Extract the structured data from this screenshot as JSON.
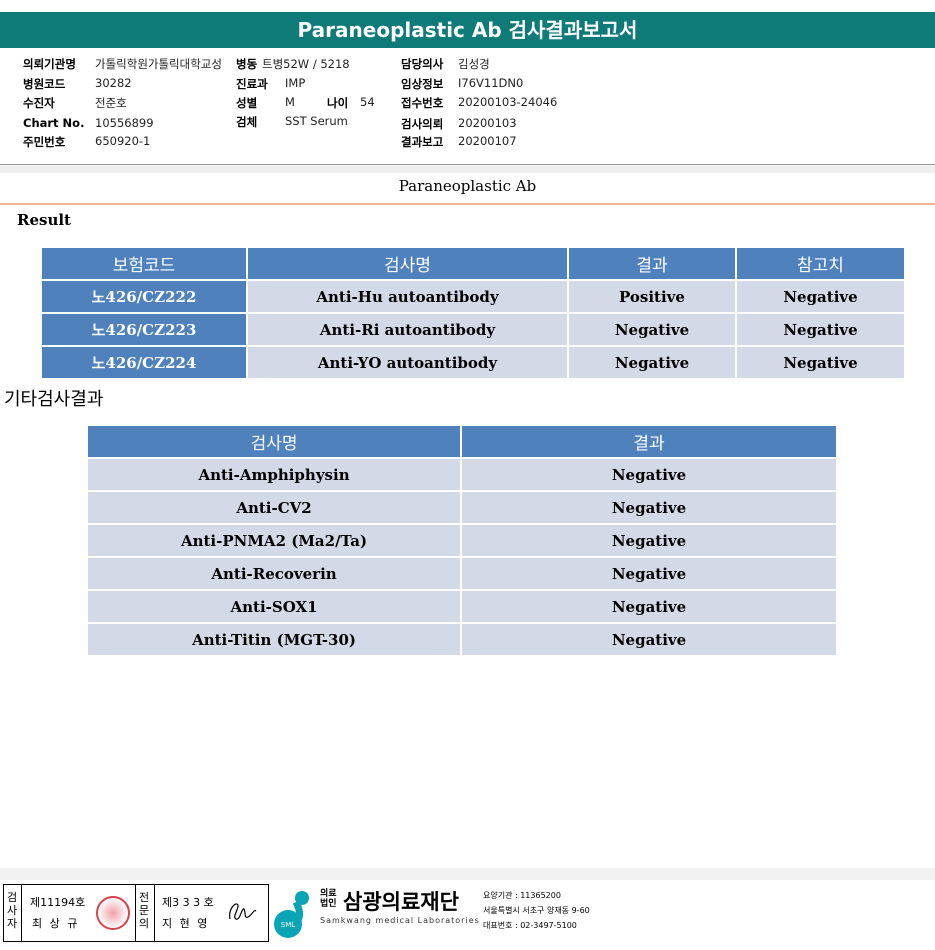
{
  "header": {
    "title": "Paraneoplastic Ab 검사결과보고서"
  },
  "info": {
    "institution_label": "의뢰기관명",
    "institution_value": "가톨릭학원가톨릭대학교성",
    "ward_label": "병동",
    "ward_value": "트병52W / 5218",
    "hospital_code_label": "병원코드",
    "hospital_code_value": "30282",
    "patient_label": "수진자",
    "patient_value": "전준호",
    "chart_label": "Chart No.",
    "chart_value": "10556899",
    "rrn_label": "주민번호",
    "rrn_value": "650920-1",
    "dept_label": "진료과",
    "dept_value": "IMP",
    "sex_label": "성별",
    "sex_value": "M",
    "age_label": "나이",
    "age_value": "54",
    "specimen_label": "검체",
    "specimen_value": "SST Serum",
    "doctor_label": "담당의사",
    "doctor_value": "김성경",
    "clinical_label": "임상정보",
    "clinical_value": "I76V11DN0",
    "receipt_label": "접수번호",
    "receipt_value": "20200103-24046",
    "request_label": "검사의뢰",
    "request_value": "20200103",
    "report_label": "결과보고",
    "report_value": "20200107"
  },
  "section": {
    "title": "Paraneoplastic Ab",
    "result_label": "Result",
    "other_label": "기타검사결과"
  },
  "results_table": {
    "headers": [
      "보험코드",
      "검사명",
      "결과",
      "참고치"
    ],
    "rows": [
      [
        "노426/CZ222",
        "Anti-Hu autoantibody",
        "Positive",
        "Negative"
      ],
      [
        "노426/CZ223",
        "Anti-Ri autoantibody",
        "Negative",
        "Negative"
      ],
      [
        "노426/CZ224",
        "Anti-YO autoantibody",
        "Negative",
        "Negative"
      ]
    ]
  },
  "other_table": {
    "headers": [
      "검사명",
      "결과"
    ],
    "rows": [
      [
        "Anti-Amphiphysin",
        "Negative"
      ],
      [
        "Anti-CV2",
        "Negative"
      ],
      [
        "Anti-PNMA2 (Ma2/Ta)",
        "Negative"
      ],
      [
        "Anti-Recoverin",
        "Negative"
      ],
      [
        "Anti-SOX1",
        "Negative"
      ],
      [
        "Anti-Titin (MGT-30)",
        "Negative"
      ]
    ]
  },
  "footer": {
    "examiner_vertical": "검사자",
    "examiner_license": "제11194호",
    "examiner_name": "최 상 규",
    "specialist_vertical": "전문의",
    "specialist_license": "제3 3 3 호",
    "specialist_name": "지 현 영",
    "logo_prefix": "의료법인",
    "logo_name": "삼광의료재단",
    "logo_english": "Samkwang medical Laboratories",
    "logo_mark_text": "SML",
    "org_code": "요양기관 : 11365200",
    "address": "서울특별시 서초구 양재동 9-60",
    "phone": "대표번호 : 02-3497-5100"
  }
}
